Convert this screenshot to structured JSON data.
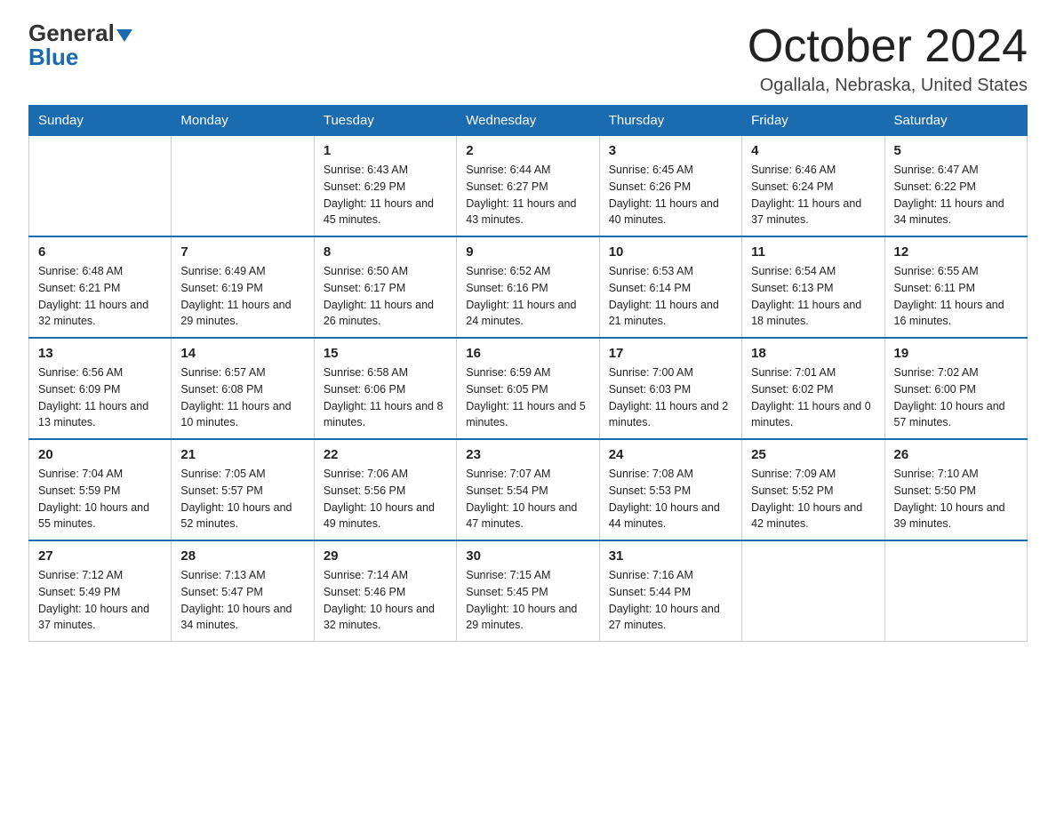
{
  "header": {
    "logo_general": "General",
    "logo_blue": "Blue",
    "month_title": "October 2024",
    "location": "Ogallala, Nebraska, United States"
  },
  "days_of_week": [
    "Sunday",
    "Monday",
    "Tuesday",
    "Wednesday",
    "Thursday",
    "Friday",
    "Saturday"
  ],
  "weeks": [
    [
      {
        "day": "",
        "info": ""
      },
      {
        "day": "",
        "info": ""
      },
      {
        "day": "1",
        "info": "Sunrise: 6:43 AM\nSunset: 6:29 PM\nDaylight: 11 hours\nand 45 minutes."
      },
      {
        "day": "2",
        "info": "Sunrise: 6:44 AM\nSunset: 6:27 PM\nDaylight: 11 hours\nand 43 minutes."
      },
      {
        "day": "3",
        "info": "Sunrise: 6:45 AM\nSunset: 6:26 PM\nDaylight: 11 hours\nand 40 minutes."
      },
      {
        "day": "4",
        "info": "Sunrise: 6:46 AM\nSunset: 6:24 PM\nDaylight: 11 hours\nand 37 minutes."
      },
      {
        "day": "5",
        "info": "Sunrise: 6:47 AM\nSunset: 6:22 PM\nDaylight: 11 hours\nand 34 minutes."
      }
    ],
    [
      {
        "day": "6",
        "info": "Sunrise: 6:48 AM\nSunset: 6:21 PM\nDaylight: 11 hours\nand 32 minutes."
      },
      {
        "day": "7",
        "info": "Sunrise: 6:49 AM\nSunset: 6:19 PM\nDaylight: 11 hours\nand 29 minutes."
      },
      {
        "day": "8",
        "info": "Sunrise: 6:50 AM\nSunset: 6:17 PM\nDaylight: 11 hours\nand 26 minutes."
      },
      {
        "day": "9",
        "info": "Sunrise: 6:52 AM\nSunset: 6:16 PM\nDaylight: 11 hours\nand 24 minutes."
      },
      {
        "day": "10",
        "info": "Sunrise: 6:53 AM\nSunset: 6:14 PM\nDaylight: 11 hours\nand 21 minutes."
      },
      {
        "day": "11",
        "info": "Sunrise: 6:54 AM\nSunset: 6:13 PM\nDaylight: 11 hours\nand 18 minutes."
      },
      {
        "day": "12",
        "info": "Sunrise: 6:55 AM\nSunset: 6:11 PM\nDaylight: 11 hours\nand 16 minutes."
      }
    ],
    [
      {
        "day": "13",
        "info": "Sunrise: 6:56 AM\nSunset: 6:09 PM\nDaylight: 11 hours\nand 13 minutes."
      },
      {
        "day": "14",
        "info": "Sunrise: 6:57 AM\nSunset: 6:08 PM\nDaylight: 11 hours\nand 10 minutes."
      },
      {
        "day": "15",
        "info": "Sunrise: 6:58 AM\nSunset: 6:06 PM\nDaylight: 11 hours\nand 8 minutes."
      },
      {
        "day": "16",
        "info": "Sunrise: 6:59 AM\nSunset: 6:05 PM\nDaylight: 11 hours\nand 5 minutes."
      },
      {
        "day": "17",
        "info": "Sunrise: 7:00 AM\nSunset: 6:03 PM\nDaylight: 11 hours\nand 2 minutes."
      },
      {
        "day": "18",
        "info": "Sunrise: 7:01 AM\nSunset: 6:02 PM\nDaylight: 11 hours\nand 0 minutes."
      },
      {
        "day": "19",
        "info": "Sunrise: 7:02 AM\nSunset: 6:00 PM\nDaylight: 10 hours\nand 57 minutes."
      }
    ],
    [
      {
        "day": "20",
        "info": "Sunrise: 7:04 AM\nSunset: 5:59 PM\nDaylight: 10 hours\nand 55 minutes."
      },
      {
        "day": "21",
        "info": "Sunrise: 7:05 AM\nSunset: 5:57 PM\nDaylight: 10 hours\nand 52 minutes."
      },
      {
        "day": "22",
        "info": "Sunrise: 7:06 AM\nSunset: 5:56 PM\nDaylight: 10 hours\nand 49 minutes."
      },
      {
        "day": "23",
        "info": "Sunrise: 7:07 AM\nSunset: 5:54 PM\nDaylight: 10 hours\nand 47 minutes."
      },
      {
        "day": "24",
        "info": "Sunrise: 7:08 AM\nSunset: 5:53 PM\nDaylight: 10 hours\nand 44 minutes."
      },
      {
        "day": "25",
        "info": "Sunrise: 7:09 AM\nSunset: 5:52 PM\nDaylight: 10 hours\nand 42 minutes."
      },
      {
        "day": "26",
        "info": "Sunrise: 7:10 AM\nSunset: 5:50 PM\nDaylight: 10 hours\nand 39 minutes."
      }
    ],
    [
      {
        "day": "27",
        "info": "Sunrise: 7:12 AM\nSunset: 5:49 PM\nDaylight: 10 hours\nand 37 minutes."
      },
      {
        "day": "28",
        "info": "Sunrise: 7:13 AM\nSunset: 5:47 PM\nDaylight: 10 hours\nand 34 minutes."
      },
      {
        "day": "29",
        "info": "Sunrise: 7:14 AM\nSunset: 5:46 PM\nDaylight: 10 hours\nand 32 minutes."
      },
      {
        "day": "30",
        "info": "Sunrise: 7:15 AM\nSunset: 5:45 PM\nDaylight: 10 hours\nand 29 minutes."
      },
      {
        "day": "31",
        "info": "Sunrise: 7:16 AM\nSunset: 5:44 PM\nDaylight: 10 hours\nand 27 minutes."
      },
      {
        "day": "",
        "info": ""
      },
      {
        "day": "",
        "info": ""
      }
    ]
  ]
}
